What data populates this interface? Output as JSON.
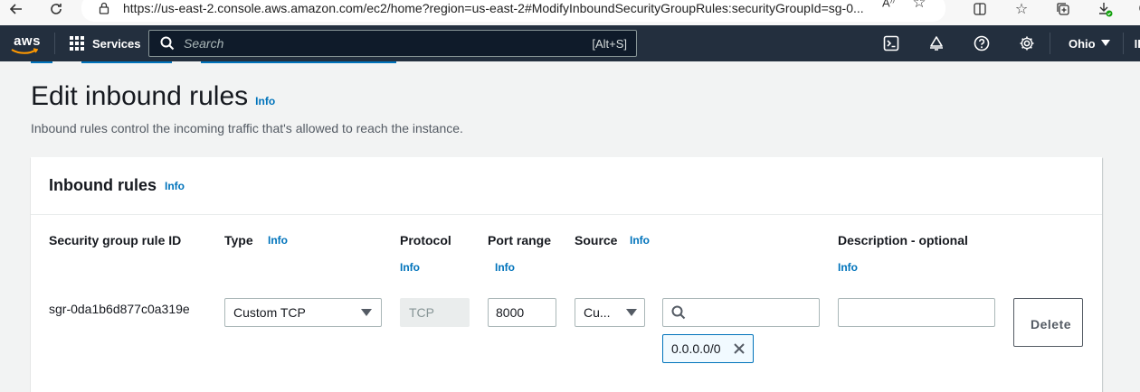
{
  "browser": {
    "url": "https://us-east-2.console.aws.amazon.com/ec2/home?region=us-east-2#ModifyInboundSecurityGroupRules:securityGroupId=sg-0..."
  },
  "aws_nav": {
    "logo_text": "aws",
    "services_label": "Services",
    "search_placeholder": "Search",
    "search_shortcut": "[Alt+S]",
    "region": "Ohio",
    "account_prefix": "IBI"
  },
  "page": {
    "title": "Edit inbound rules",
    "title_info": "Info",
    "description": "Inbound rules control the incoming traffic that's allowed to reach the instance."
  },
  "panel": {
    "title": "Inbound rules",
    "title_info": "Info",
    "columns": {
      "rule_id": "Security group rule ID",
      "type": "Type",
      "type_info": "Info",
      "protocol": "Protocol",
      "protocol_info": "Info",
      "port_range": "Port range",
      "port_range_info": "Info",
      "source": "Source",
      "source_info": "Info",
      "description": "Description - optional",
      "description_info": "Info"
    },
    "rule": {
      "id": "sgr-0da1b6d877c0a319e",
      "type": "Custom TCP",
      "protocol": "TCP",
      "port_range": "8000",
      "source_type": "Cu...",
      "source_search": "",
      "source_token": "0.0.0.0/0",
      "description": "",
      "delete_label": "Delete"
    }
  }
}
